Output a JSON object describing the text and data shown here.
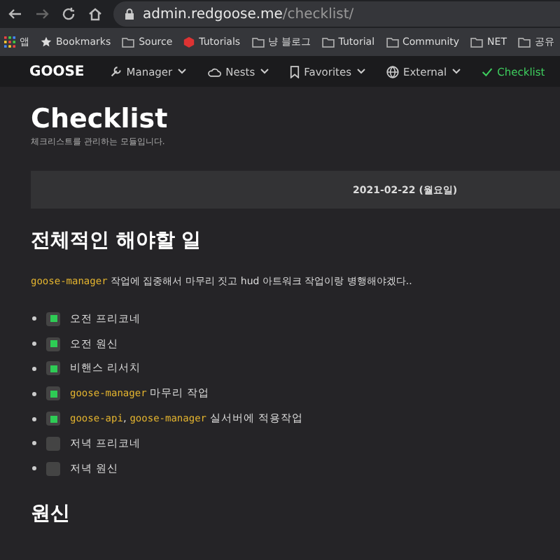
{
  "browser": {
    "url_host": "admin.redgoose.me",
    "url_path": "/checklist/",
    "bookmarks": [
      {
        "kind": "apps",
        "label": "앱"
      },
      {
        "kind": "star",
        "label": "Bookmarks"
      },
      {
        "kind": "folder",
        "label": "Source"
      },
      {
        "kind": "cube",
        "label": "Tutorials"
      },
      {
        "kind": "folder",
        "label": "냥 블로그"
      },
      {
        "kind": "folder",
        "label": "Tutorial"
      },
      {
        "kind": "folder",
        "label": "Community"
      },
      {
        "kind": "folder",
        "label": "NET"
      },
      {
        "kind": "folder",
        "label": "공유"
      }
    ]
  },
  "nav": {
    "logo": "GOOSE",
    "items": [
      {
        "kind": "wrench",
        "label": "Manager",
        "dropdown": true,
        "selected": false
      },
      {
        "kind": "cloud",
        "label": "Nests",
        "dropdown": true,
        "selected": false
      },
      {
        "kind": "bookmark",
        "label": "Favorites",
        "dropdown": true,
        "selected": false
      },
      {
        "kind": "globe",
        "label": "External",
        "dropdown": true,
        "selected": false
      },
      {
        "kind": "check",
        "label": "Checklist",
        "dropdown": false,
        "selected": true
      }
    ]
  },
  "page": {
    "title": "Checklist",
    "subtitle": "체크리스트를 관리하는 모듈입니다.",
    "date": "2021-02-22 (월요일)"
  },
  "sections": [
    {
      "heading": "전체적인 해야할 일",
      "paragraph": [
        {
          "kind": "code",
          "text": "goose-manager"
        },
        {
          "kind": "text",
          "text": " 작업에 집중해서 마무리 짓고 hud 아트워크 작업이랑 병행해야겠다.."
        }
      ],
      "items": [
        {
          "checked": true,
          "parts": [
            {
              "kind": "text",
              "text": "오전 프리코네"
            }
          ]
        },
        {
          "checked": true,
          "parts": [
            {
              "kind": "text",
              "text": "오전 원신"
            }
          ]
        },
        {
          "checked": true,
          "parts": [
            {
              "kind": "text",
              "text": "비핸스 리서치"
            }
          ]
        },
        {
          "checked": true,
          "parts": [
            {
              "kind": "code",
              "text": "goose-manager"
            },
            {
              "kind": "text",
              "text": " 마무리 작업"
            }
          ]
        },
        {
          "checked": true,
          "parts": [
            {
              "kind": "code",
              "text": "goose-api"
            },
            {
              "kind": "text",
              "text": ", "
            },
            {
              "kind": "code",
              "text": "goose-manager"
            },
            {
              "kind": "text",
              "text": " 실서버에 적용작업"
            }
          ]
        },
        {
          "checked": false,
          "parts": [
            {
              "kind": "text",
              "text": "저녁 프리코네"
            }
          ]
        },
        {
          "checked": false,
          "parts": [
            {
              "kind": "text",
              "text": "저녁 원신"
            }
          ]
        }
      ]
    },
    {
      "heading": "원신"
    }
  ]
}
